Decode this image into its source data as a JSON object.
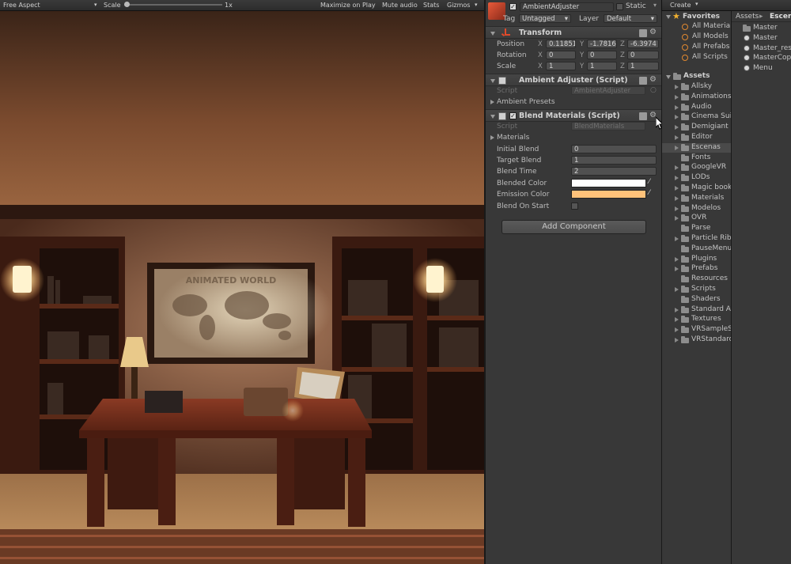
{
  "game_toolbar": {
    "aspect": "Free Aspect",
    "scale_label": "Scale",
    "scale_value": "1x",
    "maximize": "Maximize on Play",
    "mute": "Mute audio",
    "stats": "Stats",
    "gizmos": "Gizmos"
  },
  "inspector": {
    "object_name": "AmbientAdjuster",
    "static_label": "Static",
    "tag_label": "Tag",
    "tag_value": "Untagged",
    "layer_label": "Layer",
    "layer_value": "Default",
    "transform": {
      "title": "Transform",
      "position_label": "Position",
      "position": {
        "x": "0.11851",
        "y": "-1.7816",
        "z": "-6.3974"
      },
      "rotation_label": "Rotation",
      "rotation": {
        "x": "0",
        "y": "0",
        "z": "0"
      },
      "scale_label": "Scale",
      "scale": {
        "x": "1",
        "y": "1",
        "z": "1"
      },
      "axis_x": "X",
      "axis_y": "Y",
      "axis_z": "Z"
    },
    "ambient": {
      "title": "Ambient Adjuster (Script)",
      "script_label": "Script",
      "script_value": "AmbientAdjuster",
      "presets_label": "Ambient Presets"
    },
    "blend": {
      "title": "Blend Materials (Script)",
      "script_label": "Script",
      "script_value": "BlendMaterials",
      "materials_label": "Materials",
      "initial_blend_label": "Initial Blend",
      "initial_blend": "0",
      "target_blend_label": "Target Blend",
      "target_blend": "1",
      "blend_time_label": "Blend Time",
      "blend_time": "2",
      "blended_color_label": "Blended Color",
      "blended_color": "#ffffff",
      "emission_color_label": "Emission Color",
      "emission_color": "#ffc27a",
      "blend_on_start_label": "Blend On Start"
    },
    "add_component": "Add Component"
  },
  "project": {
    "create": "Create",
    "favorites_title": "Favorites",
    "favorites": [
      "All Materials",
      "All Models",
      "All Prefabs",
      "All Scripts"
    ],
    "assets_title": "Assets",
    "folders": [
      "Allsky",
      "Animations",
      "Audio",
      "Cinema Suite",
      "Demigiant",
      "Editor",
      "Escenas",
      "Fonts",
      "GoogleVR",
      "LODs",
      "Magic book",
      "Materials",
      "Modelos",
      "OVR",
      "Parse",
      "Particle Ribbon",
      "PauseMenu",
      "Plugins",
      "Prefabs",
      "Resources",
      "Scripts",
      "Shaders",
      "Standard Assets",
      "Textures",
      "VRSampleScenes",
      "VRStandardAssets"
    ],
    "breadcrumb_root": "Assets",
    "breadcrumb_current": "Escenas",
    "files": [
      {
        "name": "Master",
        "kind": "folder"
      },
      {
        "name": "Master",
        "kind": "scene"
      },
      {
        "name": "Master_res",
        "kind": "scene"
      },
      {
        "name": "MasterCopy",
        "kind": "scene"
      },
      {
        "name": "Menu",
        "kind": "scene"
      }
    ]
  },
  "scene": {
    "map_title": "ANIMATED WORLD"
  }
}
